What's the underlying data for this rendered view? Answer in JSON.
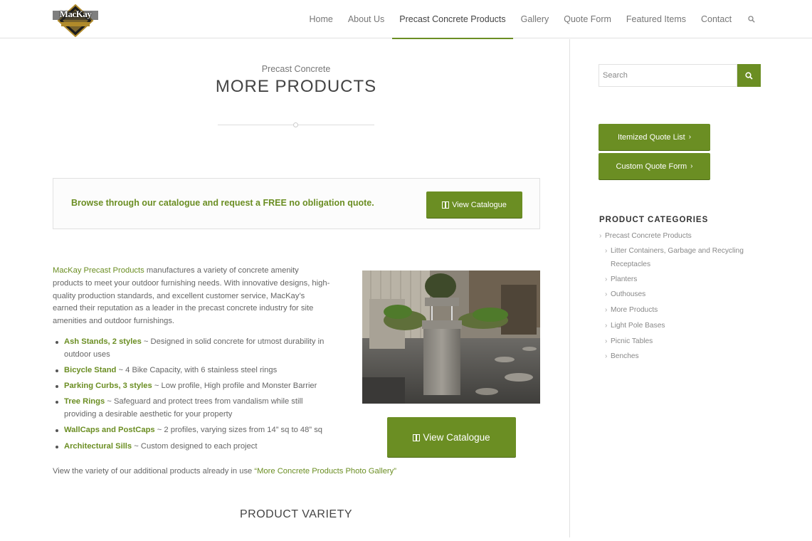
{
  "header": {
    "logo_text": "MacKay",
    "nav": [
      "Home",
      "About Us",
      "Precast Concrete Products",
      "Gallery",
      "Quote Form",
      "Featured Items",
      "Contact"
    ],
    "active_nav": "Precast Concrete Products"
  },
  "hero": {
    "subtitle": "Precast Concrete",
    "title": "MORE PRODUCTS"
  },
  "promo": {
    "text": "Browse through our catalogue and request a FREE no obligation quote.",
    "button": "View Catalogue"
  },
  "intro": {
    "brand": "MacKay Precast Products",
    "text": " manufactures a variety of concrete amenity products to meet your outdoor furnishing needs. With innovative designs, high-quality production standards, and excellent customer service, MacKay’s earned their reputation as a leader in the precast concrete industry for site amenities and outdoor furnishings."
  },
  "features": [
    {
      "name": "Ash Stands, 2 styles",
      "desc": " ~ Designed in solid concrete for utmost durability in outdoor uses"
    },
    {
      "name": "Bicycle Stand",
      "desc": " ~ 4 Bike Capacity, with 6 stainless steel rings"
    },
    {
      "name": "Parking Curbs, 3 styles",
      "desc": " ~ Low profile, High profile and Monster Barrier"
    },
    {
      "name": "Tree Rings",
      "desc": " ~ Safeguard and protect trees from vandalism while still providing a desirable aesthetic for your property"
    },
    {
      "name": "WallCaps and PostCaps",
      "desc": " ~ 2 profiles, varying sizes from 14” sq to 48” sq"
    },
    {
      "name": "Architectural Sills",
      "desc": " ~ Custom designed to each project"
    }
  ],
  "outro": {
    "text": "View the variety of our additional products already in use ",
    "link": " “More Concrete Products Photo Gallery”"
  },
  "catalogue_button": "View Catalogue",
  "variety_heading": "PRODUCT VARIETY",
  "sidebar": {
    "search_placeholder": "Search",
    "buttons": [
      "Itemized Quote List",
      "Custom Quote Form"
    ],
    "categories_title": "PRODUCT CATEGORIES",
    "categories_root": "Precast Concrete Products",
    "categories": [
      "Litter Containers, Garbage and Recycling Receptacles",
      "Planters",
      "Outhouses",
      "More Products",
      "Light Pole Bases",
      "Picnic Tables",
      "Benches"
    ]
  },
  "colors": {
    "accent": "#6b8e23"
  },
  "icons": [
    "search-icon",
    "book-icon",
    "chevron-right-icon"
  ]
}
